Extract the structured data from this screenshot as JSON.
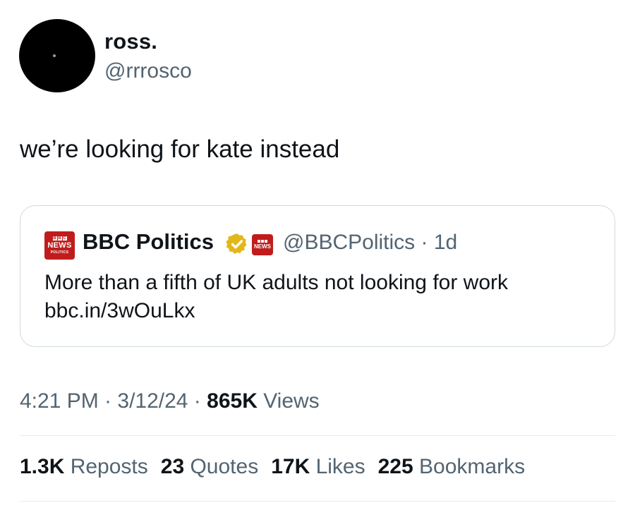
{
  "author": {
    "display_name": "ross.",
    "handle": "@rrrosco",
    "avatar_icon": "avatar-image"
  },
  "tweet": {
    "text": "we’re looking for kate instead"
  },
  "quoted_tweet": {
    "logo_text": "NEWS",
    "logo_subtext": "POLITICS",
    "display_name": "BBC Politics",
    "verified_icon": "gold-verified-badge-icon",
    "verified_color": "#e2b719",
    "badge_text": "NEWS",
    "handle_meta": "@BBCPolitics · 1d",
    "text_line1": "More than a fifth of UK adults not looking for work",
    "text_line2": "bbc.in/3wOuLkx",
    "brand_color": "#c01c1c"
  },
  "meta": {
    "timestamp": "4:21 PM · 3/12/24 · ",
    "views_count": "865K",
    "views_label": " Views"
  },
  "stats": {
    "reposts_count": "1.3K",
    "reposts_label": " Reposts",
    "quotes_count": "23",
    "quotes_label": " Quotes",
    "likes_count": "17K",
    "likes_label": " Likes",
    "bookmarks_count": "225",
    "bookmarks_label": " Bookmarks"
  },
  "colors": {
    "text_primary": "#0f1419",
    "text_secondary": "#536471",
    "border": "#cfd9de"
  }
}
